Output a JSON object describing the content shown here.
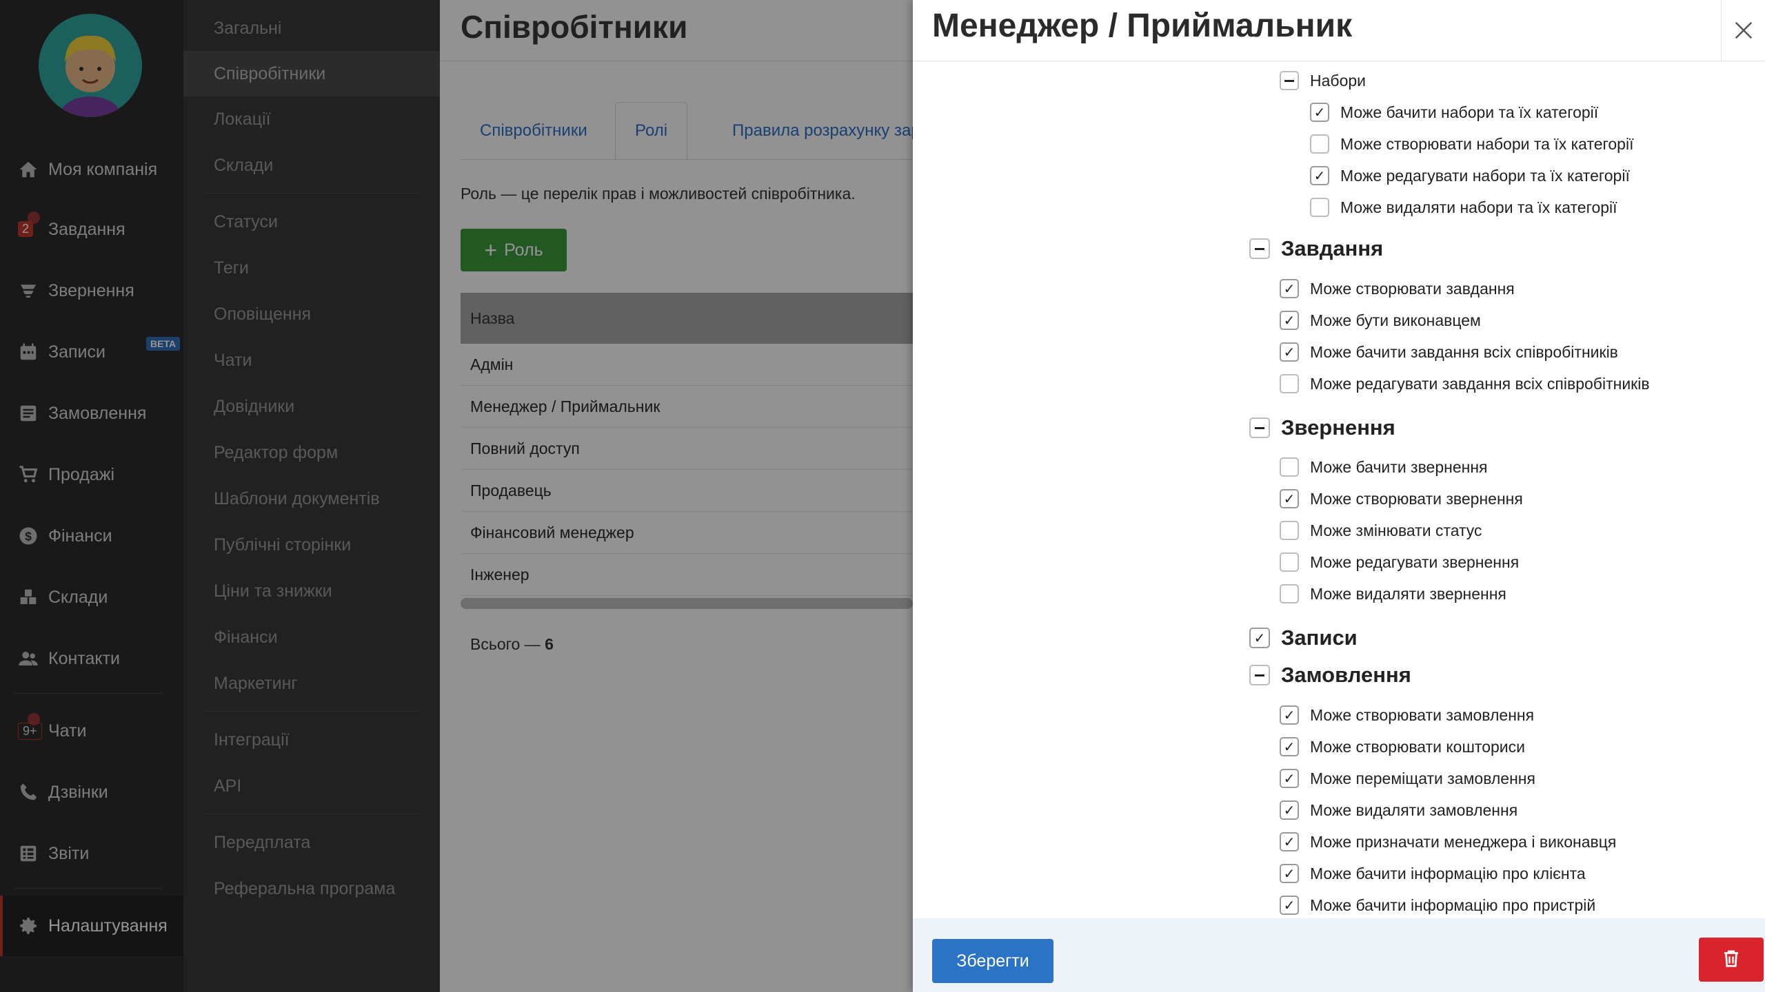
{
  "main_nav": {
    "items": [
      {
        "label": "Моя компанія",
        "icon": "home-icon"
      },
      {
        "label": "Завдання",
        "icon": "tasks-icon",
        "badge": "2"
      },
      {
        "label": "Звернення",
        "icon": "inbox-icon"
      },
      {
        "label": "Записи",
        "icon": "calendar-icon",
        "tag": "BETA"
      },
      {
        "label": "Замовлення",
        "icon": "orders-icon"
      },
      {
        "label": "Продажі",
        "icon": "cart-icon"
      },
      {
        "label": "Фінанси",
        "icon": "dollar-icon"
      },
      {
        "label": "Склади",
        "icon": "warehouse-icon"
      },
      {
        "label": "Контакти",
        "icon": "contacts-icon"
      },
      {
        "label": "Чати",
        "icon": "chat-icon",
        "badge": "9+"
      },
      {
        "label": "Дзвінки",
        "icon": "phone-icon"
      },
      {
        "label": "Звіти",
        "icon": "reports-icon"
      },
      {
        "label": "Налаштування",
        "icon": "gear-icon"
      }
    ]
  },
  "settings_nav": {
    "items": [
      "Загальні",
      "Співробітники",
      "Локації",
      "Склади",
      "Статуси",
      "Теги",
      "Оповіщення",
      "Чати",
      "Довідники",
      "Редактор форм",
      "Шаблони документів",
      "Публічні сторінки",
      "Ціни та знижки",
      "Фінанси",
      "Маркетинг",
      "Інтеграції",
      "API",
      "Передплата",
      "Реферальна програма"
    ]
  },
  "content": {
    "title": "Співробітники",
    "tabs": [
      "Співробітники",
      "Ролі",
      "Правила розрахунку зарпл"
    ],
    "description": "Роль — це перелік прав і можливостей співробітника.",
    "add_role_label": "Роль",
    "table_header": "Назва",
    "roles": [
      "Адмін",
      "Менеджер / Приймальник",
      "Повний доступ",
      "Продавець",
      "Фінансовий менеджер",
      "Інженер"
    ],
    "total_label": "Всього — ",
    "total_value": "6"
  },
  "drawer": {
    "title": "Менеджер / Приймальник",
    "permissions": [
      {
        "label": "Набори",
        "state": "partial",
        "level": "subgroup"
      },
      {
        "label": "Може бачити набори та їх категорії",
        "state": "checked",
        "level": "subitem"
      },
      {
        "label": "Може створювати набори та їх категорії",
        "state": "unchecked",
        "level": "subitem"
      },
      {
        "label": "Може редагувати набори та їх категорії",
        "state": "checked",
        "level": "subitem"
      },
      {
        "label": "Може видаляти набори та їх категорії",
        "state": "unchecked",
        "level": "subitem"
      },
      {
        "label": "Завдання",
        "state": "partial",
        "level": "group"
      },
      {
        "label": "Може створювати завдання",
        "state": "checked",
        "level": "item"
      },
      {
        "label": "Може бути виконавцем",
        "state": "checked",
        "level": "item"
      },
      {
        "label": "Може бачити завдання всіх співробітників",
        "state": "checked",
        "level": "item"
      },
      {
        "label": "Може редагувати завдання всіх співробітників",
        "state": "unchecked",
        "level": "item"
      },
      {
        "label": "Звернення",
        "state": "partial",
        "level": "group"
      },
      {
        "label": "Може бачити звернення",
        "state": "unchecked",
        "level": "item"
      },
      {
        "label": "Може створювати звернення",
        "state": "checked",
        "level": "item"
      },
      {
        "label": "Може змінювати статус",
        "state": "unchecked",
        "level": "item"
      },
      {
        "label": "Може редагувати звернення",
        "state": "unchecked",
        "level": "item"
      },
      {
        "label": "Може видаляти звернення",
        "state": "unchecked",
        "level": "item"
      },
      {
        "label": "Записи",
        "state": "checked",
        "level": "group"
      },
      {
        "label": "Замовлення",
        "state": "partial",
        "level": "group"
      },
      {
        "label": "Може створювати замовлення",
        "state": "checked",
        "level": "item"
      },
      {
        "label": "Може створювати кошториси",
        "state": "checked",
        "level": "item"
      },
      {
        "label": "Може переміщати замовлення",
        "state": "checked",
        "level": "item"
      },
      {
        "label": "Може видаляти замовлення",
        "state": "checked",
        "level": "item"
      },
      {
        "label": "Може призначати менеджера і виконавця",
        "state": "checked",
        "level": "item"
      },
      {
        "label": "Може бачити інформацію про клієнта",
        "state": "checked",
        "level": "item"
      },
      {
        "label": "Може бачити інформацію про пристрій",
        "state": "checked",
        "level": "item"
      }
    ],
    "save_label": "Зберегти"
  },
  "colors": {
    "accent_blue": "#2a73c5",
    "add_green": "#3b9a3b",
    "delete_red": "#d9232d",
    "nav_dark": "#2b2b2b"
  }
}
